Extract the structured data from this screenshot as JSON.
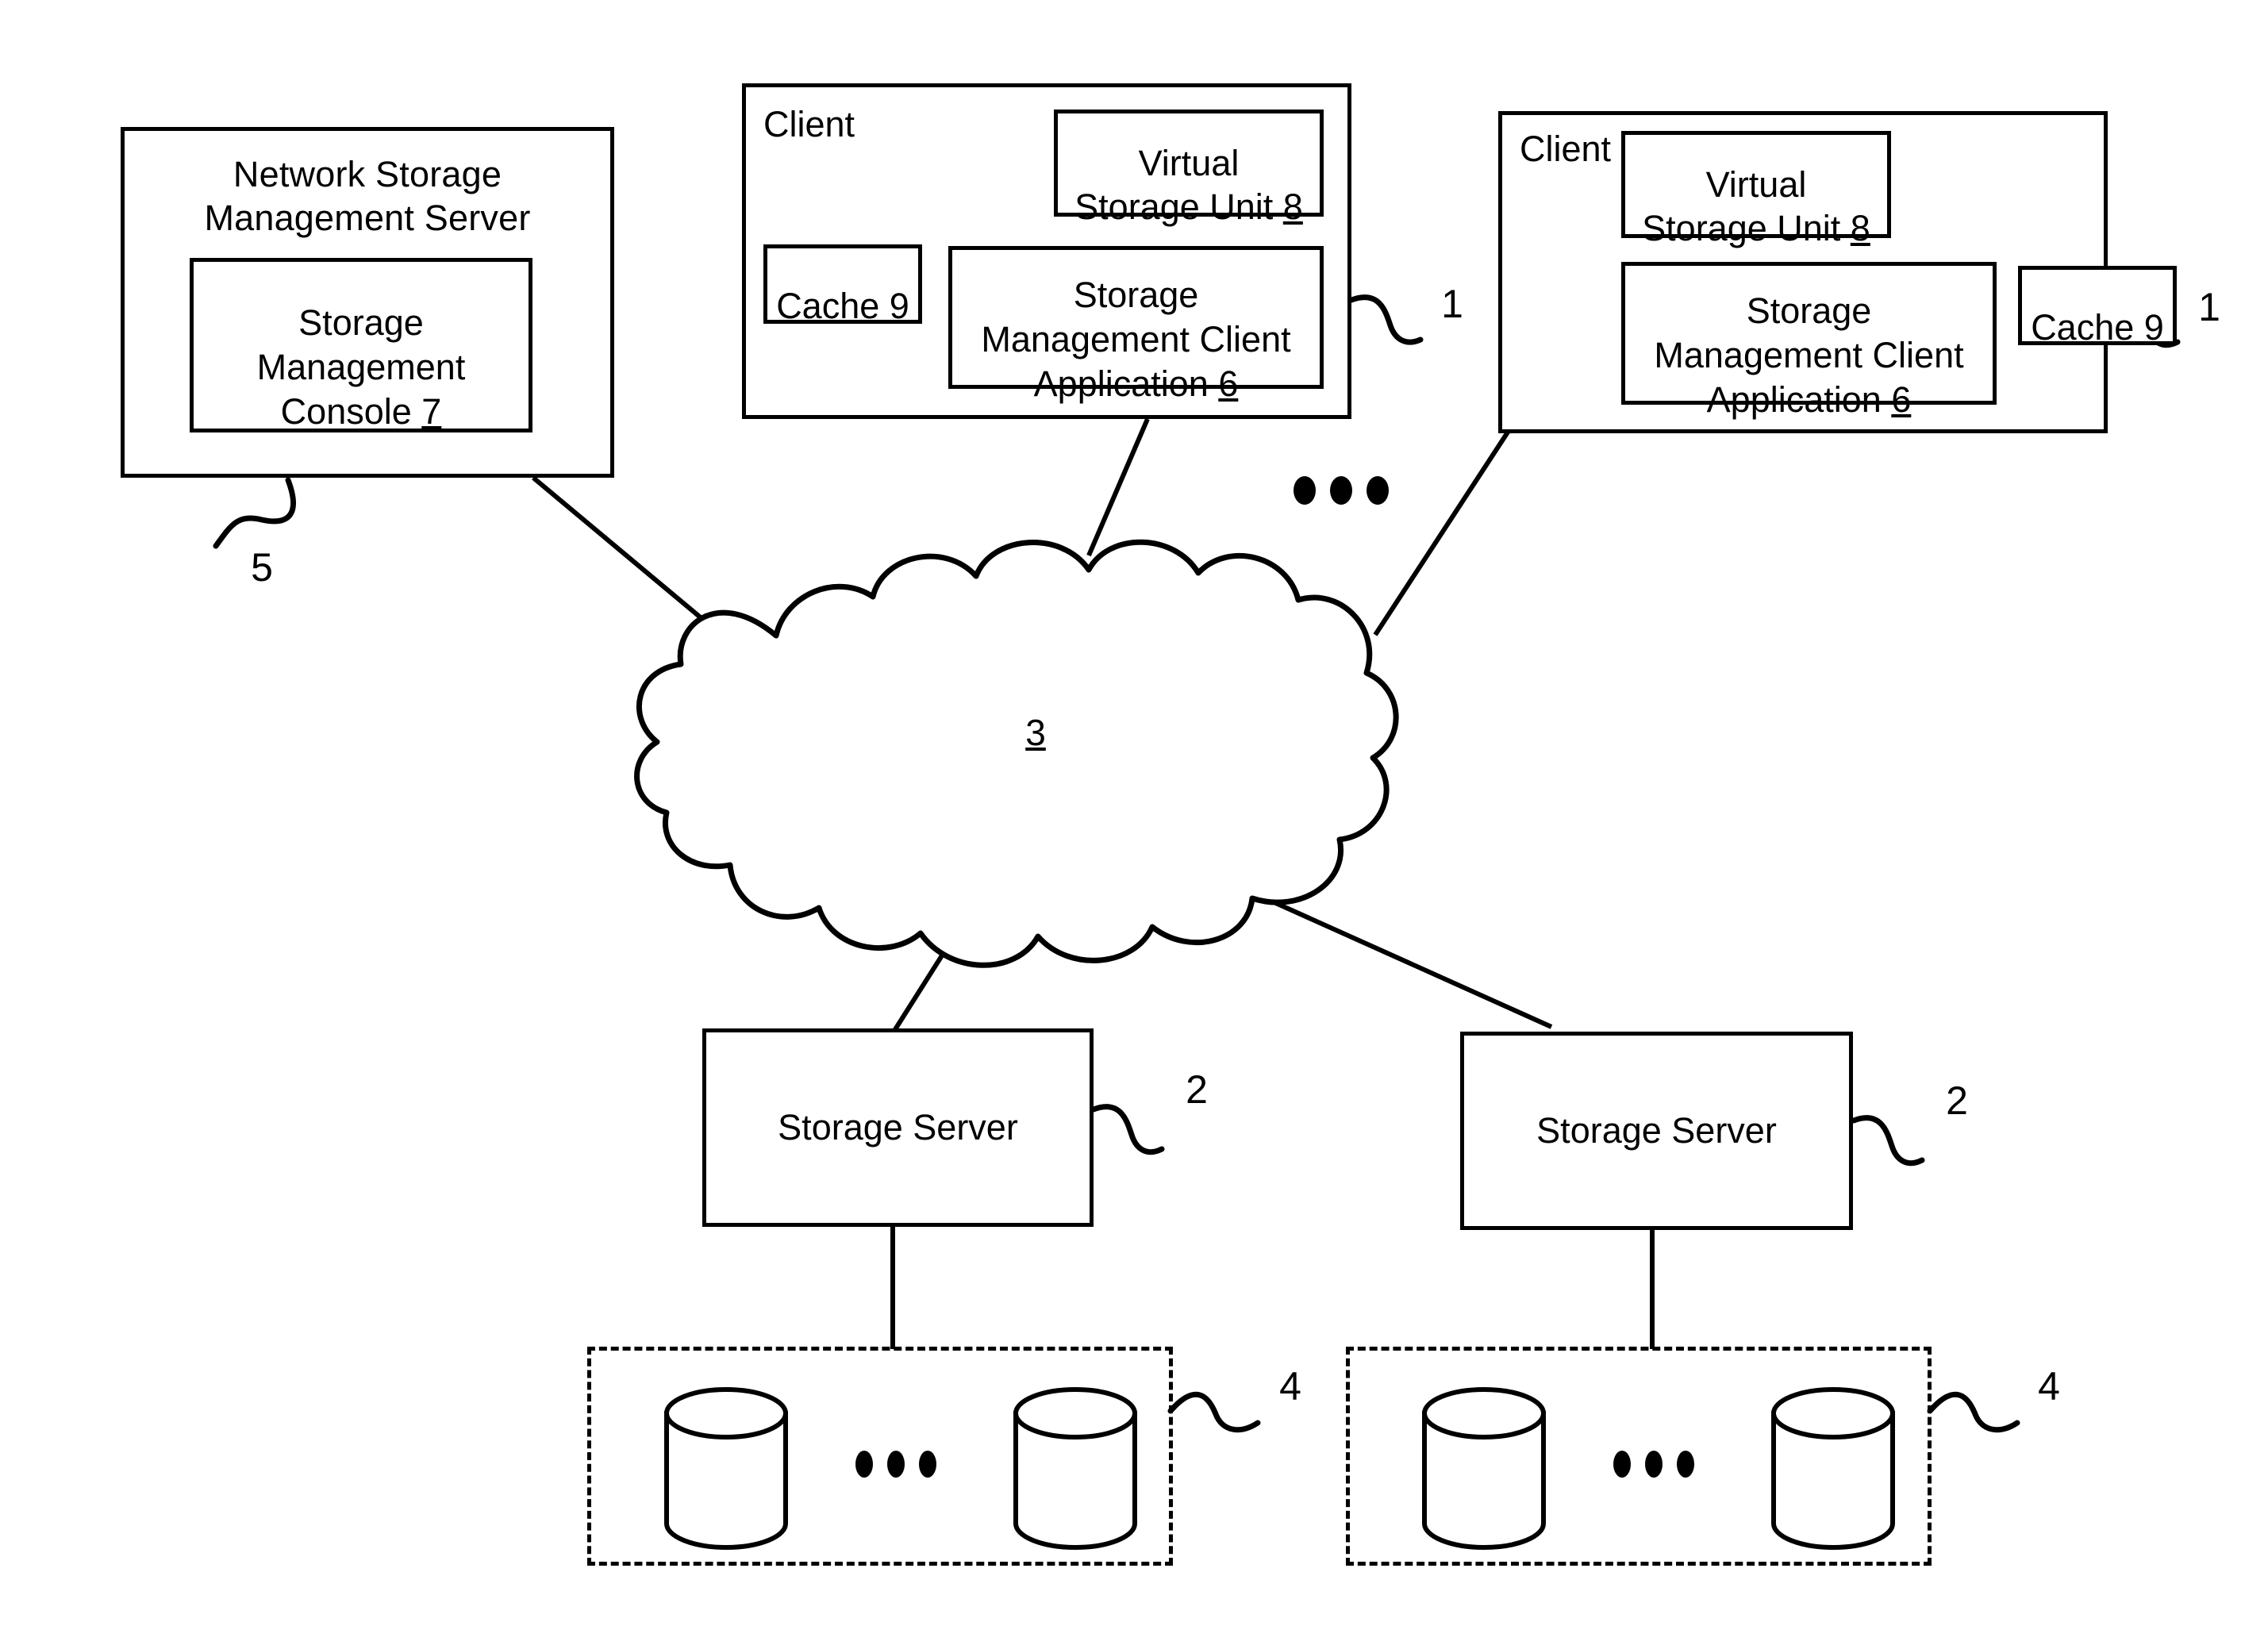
{
  "figure": {
    "type": "patent-network-architecture-diagram",
    "background_color": "#ffffff",
    "line_color": "#000000"
  },
  "management_server": {
    "title": "Network Storage\nManagement Server",
    "console": {
      "label_lines": "Storage\nManagement\nConsole ",
      "label_plain": "Storage Management Console 7",
      "ref": "7"
    },
    "ref": "5"
  },
  "clients": [
    {
      "label": "Client",
      "ref": "1",
      "virtual_storage_unit": {
        "label_lines": "Virtual\nStorage Unit ",
        "label_plain": "Virtual Storage Unit 8",
        "ref": "8"
      },
      "cache": {
        "label_lines": "Cache ",
        "label_plain": "Cache 9",
        "ref": "9"
      },
      "client_application": {
        "label_lines": "Storage\nManagement Client\nApplication ",
        "label_plain": "Storage Management Client Application 6",
        "ref": "6"
      }
    },
    {
      "label": "Client",
      "ref": "1",
      "virtual_storage_unit": {
        "label_lines": "Virtual\nStorage Unit ",
        "label_plain": "Virtual Storage Unit 8",
        "ref": "8"
      },
      "cache": {
        "label_lines": "Cache ",
        "label_plain": "Cache 9",
        "ref": "9"
      },
      "client_application": {
        "label_lines": "Storage\nManagement Client\nApplication ",
        "label_plain": "Storage Management Client Application 6",
        "ref": "6"
      }
    }
  ],
  "network_cloud": {
    "ref": "3",
    "shape": "cloud"
  },
  "storage_servers": [
    {
      "label": "Storage Server",
      "ref": "2"
    },
    {
      "label": "Storage Server",
      "ref": "2"
    }
  ],
  "storage_arrays": [
    {
      "ref": "4",
      "disk_count_shown": 2,
      "ellipsis_dots": 3
    },
    {
      "ref": "4",
      "disk_count_shown": 2,
      "ellipsis_dots": 3
    }
  ],
  "client_ellipsis": {
    "dots": 3
  }
}
